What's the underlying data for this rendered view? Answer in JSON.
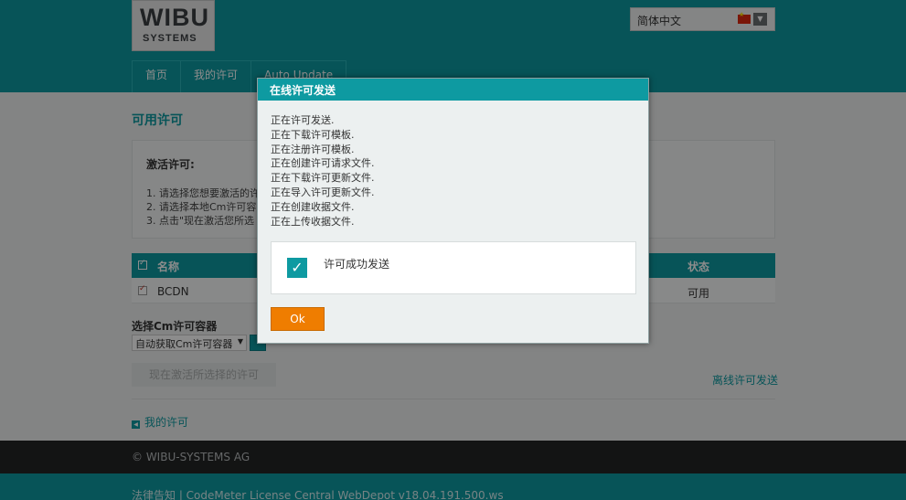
{
  "header": {
    "logo_top": "WIBU",
    "logo_bottom": "SYSTEMS",
    "language": "简体中文"
  },
  "nav": [
    {
      "label": "首页"
    },
    {
      "label": "我的许可"
    },
    {
      "label": "Auto Update"
    }
  ],
  "page": {
    "title": "可用许可",
    "activate": {
      "heading": "激活许可:",
      "steps": [
        "1. 请选择您想要激活的许",
        "2. 请选择本地Cm许可容",
        "3. 点击\"现在激活您所选"
      ]
    },
    "table": {
      "col_name": "名称",
      "col_status": "状态",
      "rows": [
        {
          "name": "BCDN",
          "status": "可用"
        }
      ]
    },
    "select_label": "选择Cm许可容器",
    "select_value": "自动获取Cm许可容器",
    "activate_button": "现在激活所选择的许可",
    "offline_link": "离线许可发送",
    "back_link": "我的许可"
  },
  "footer": {
    "copyright": "© WIBU-SYSTEMS AG",
    "legal": "法律告知 | CodeMeter License Central WebDepot v18.04.191.500.ws"
  },
  "dialog": {
    "title": "在线许可发送",
    "messages": [
      "正在许可发送.",
      "正在下载许可模板.",
      "正在注册许可模板.",
      "正在创建许可请求文件.",
      "正在下载许可更新文件.",
      "正在导入许可更新文件.",
      "正在创建收据文件.",
      "正在上传收据文件."
    ],
    "success_text": "许可成功发送",
    "ok_label": "Ok"
  },
  "colors": {
    "brand_teal": "#0e9aa1",
    "ok_orange": "#ef7d00",
    "footer_dark": "#232526"
  }
}
